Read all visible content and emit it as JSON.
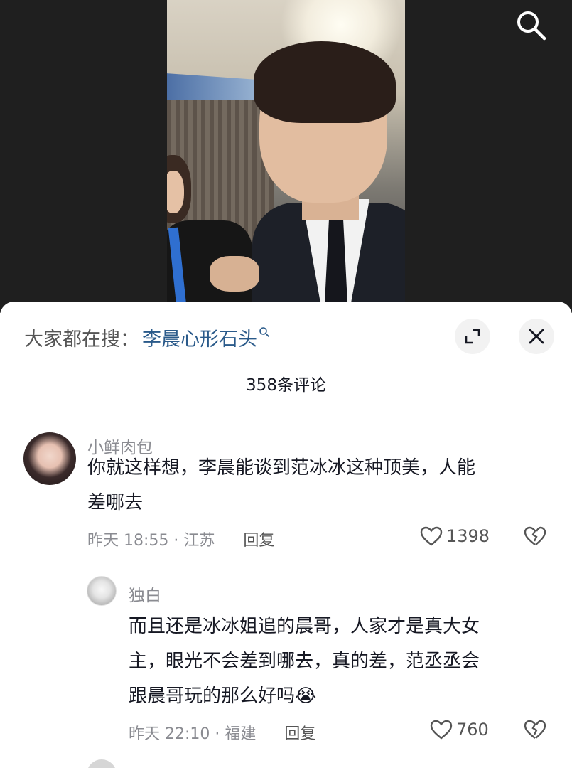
{
  "video": {
    "search_icon": "search-icon"
  },
  "sheet": {
    "search_prefix": "大家都在搜：",
    "search_query": "李晨心形石头",
    "comment_count": "358条评论",
    "expand_icon": "expand-icon",
    "close_icon": "close-icon"
  },
  "comments": [
    {
      "user": "小鲜肉包",
      "text_line1": "你就这样想，李晨能谈到范冰冰这种顶美，人能",
      "text_line2": "差哪去",
      "time_location": "昨天 18:55 · 江苏",
      "reply_label": "回复",
      "likes": "1398"
    },
    {
      "user": "独白",
      "text_line1": "而且还是冰冰姐追的晨哥，人家才是真大女",
      "text_line2": "主，眼光不会差到哪去，真的差，范丞丞会",
      "text_line3": "跟晨哥玩的那么好吗😭",
      "time_location": "昨天 22:10 · 福建",
      "reply_label": "回复",
      "likes": "760"
    }
  ],
  "colors": {
    "accent_link": "#2a5a8a",
    "text_primary": "#161823",
    "text_secondary": "#8a8b91"
  }
}
